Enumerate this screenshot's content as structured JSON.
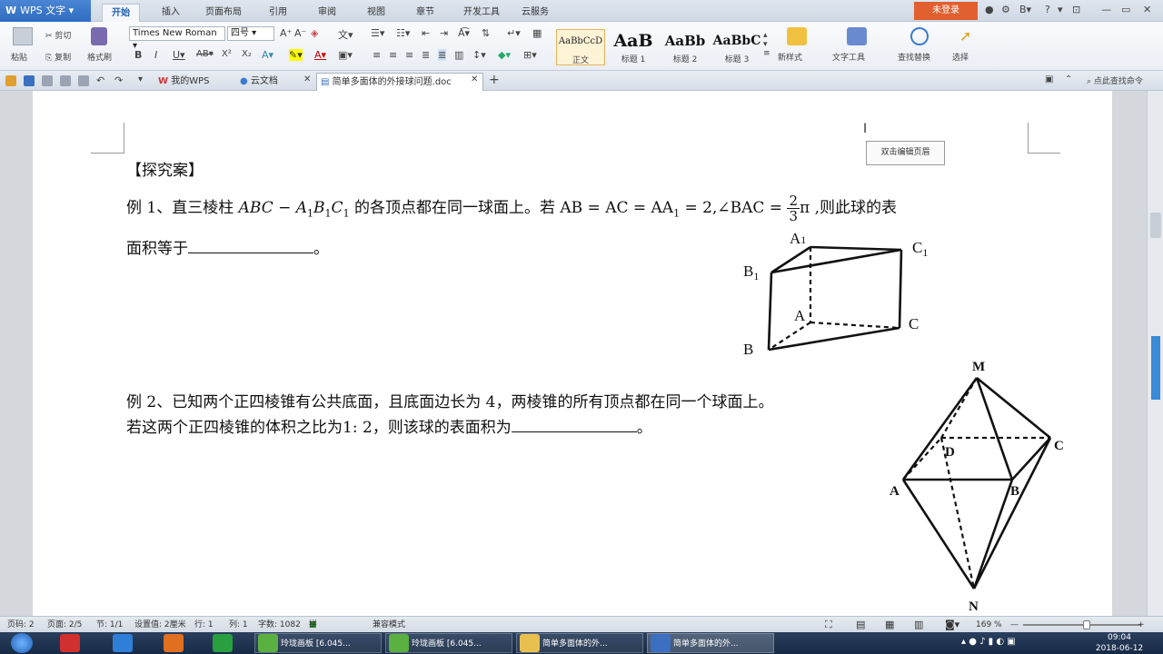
{
  "app": {
    "menu_label": "WPS 文字",
    "ribbon_tabs": [
      "开始",
      "插入",
      "页面布局",
      "引用",
      "审阅",
      "视图",
      "章节",
      "开发工具",
      "云服务"
    ],
    "login_label": "未登录"
  },
  "ribbon": {
    "paste": "粘贴",
    "cut": "剪切",
    "copy": "复制",
    "format_painter": "格式刷",
    "font_name": "Times New Roman",
    "font_size": "四号",
    "styles": [
      {
        "preview": "AaBbCcD",
        "label": "正文"
      },
      {
        "preview": "AaB",
        "label": "标题 1"
      },
      {
        "preview": "AaBb",
        "label": "标题 2"
      },
      {
        "preview": "AaBbC",
        "label": "标题 3"
      }
    ],
    "new_style": "新样式",
    "text_tools": "文字工具",
    "find_replace": "查找替换",
    "select": "选择"
  },
  "doc_tabs": [
    {
      "label": "我的WPS"
    },
    {
      "label": "云文档"
    },
    {
      "label": "简单多面体的外接球问题.doc"
    }
  ],
  "find_command": "点此查找命令",
  "tooltip": "双击编辑页眉",
  "document": {
    "heading": "【探究案】",
    "ex1_pre": "例 1、直三棱柱 ",
    "ex1_math1": "ABC − A",
    "ex1_math_sub1": "1",
    "ex1_math2": "B",
    "ex1_math_sub2": "1",
    "ex1_math3": "C",
    "ex1_math_sub3": "1",
    "ex1_mid": " 的各顶点都在同一球面上。若 AB = AC = AA",
    "ex1_sub4": "1",
    "ex1_eq": " = 2,∠BAC = ",
    "ex1_frac_num": "2",
    "ex1_frac_den": "3",
    "ex1_post": "π ,则此球的表",
    "ex1_line2": "面积等于",
    "ex1_end": "。",
    "ex2_line1": "例 2、已知两个正四棱锥有公共底面，且底面边长为 4，两棱锥的所有顶点都在同一个球面上。",
    "ex2_line2": "若这两个正四棱锥的体积之比为1: 2，则该球的表面积为",
    "ex2_end": "。",
    "prism_labels": {
      "A1": "A",
      "A1s": "1",
      "B1": "B",
      "B1s": "1",
      "C1": "C",
      "C1s": "1",
      "A": "A",
      "B": "B",
      "C": "C"
    },
    "bipyramid_labels": {
      "M": "M",
      "D": "D",
      "C": "C",
      "A": "A",
      "B": "B",
      "N": "N"
    }
  },
  "status": {
    "page_num": "页码: 2",
    "pages": "页面: 2/5",
    "section": "节: 1/1",
    "position": "设置值: 2厘米",
    "row": "行: 1",
    "col": "列: 1",
    "word_count": "字数: 1082",
    "spell": "拼写检查",
    "compat": "兼容模式",
    "zoom": "169 %"
  },
  "taskbar": {
    "items": [
      "玲珑画板 [6.045...",
      "玲珑画板 [6.045...",
      "简单多面体的外...",
      "简单多面体的外..."
    ],
    "time": "09:04",
    "date": "2018-06-12"
  }
}
